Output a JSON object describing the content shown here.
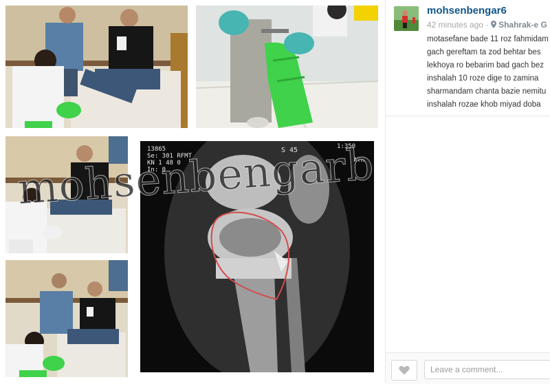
{
  "post": {
    "username": "mohsenbengar6",
    "time": "42 minutes ago",
    "location": "Shahrak-e G",
    "caption_lines": [
      "motasefane bade 11 roz fahmidam",
      "gach gereftam ta zod behtar bes",
      "lekhoya ro bebarim bad gach bez",
      "inshalah 10 roze dige to zamina",
      "sharmandam chanta bazie nemitu",
      "inshalah rozae khob miyad doba"
    ]
  },
  "photo": {
    "watermark": "mohsenbengarb",
    "xray_labels": {
      "top_left": [
        "13865",
        "Se: 301 RFMT",
        "KN 1 48 0",
        "In: 0"
      ],
      "top_right_1": "S 45",
      "top_right_2": "1:350",
      "top_right_3": "ATH"
    }
  },
  "comment": {
    "placeholder": "Leave a comment..."
  },
  "icons": {
    "like": "heart-icon",
    "location": "location-pin-icon"
  },
  "colors": {
    "username": "#125688",
    "cast_green": "#3fd24a",
    "meta_gray": "#a5a7aa"
  }
}
